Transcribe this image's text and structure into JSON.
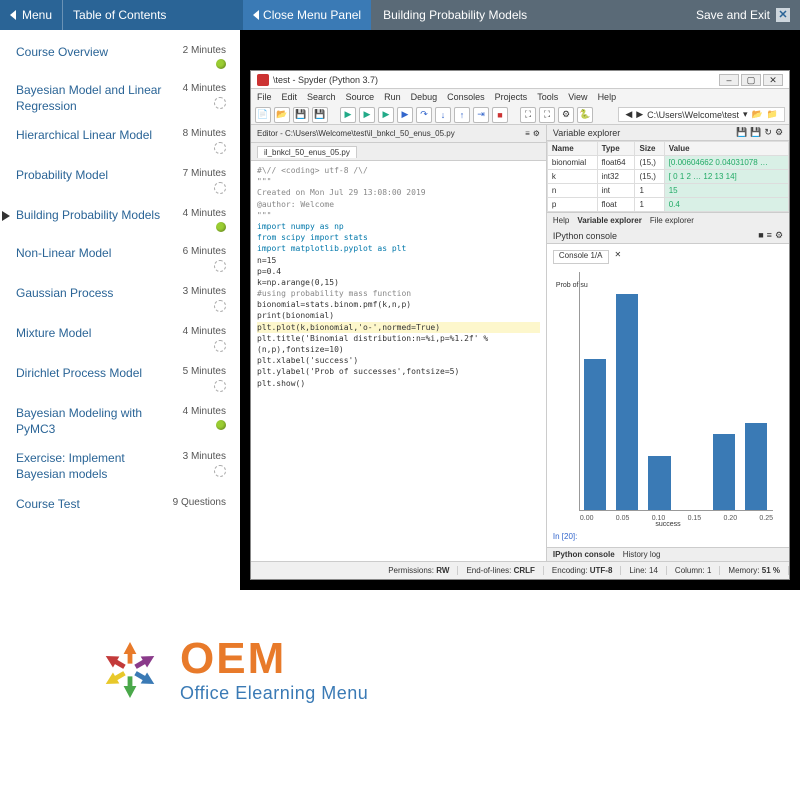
{
  "topbar": {
    "menu": "Menu",
    "toc": "Table of Contents",
    "close_panel": "Close Menu Panel",
    "title": "Building Probability Models",
    "save": "Save and Exit"
  },
  "sidebar": {
    "items": [
      {
        "label": "Course Overview",
        "meta": "2 Minutes",
        "status": "done",
        "active": false
      },
      {
        "label": "Bayesian Model and Linear Regression",
        "meta": "4 Minutes",
        "status": "loading",
        "active": false
      },
      {
        "label": "Hierarchical Linear Model",
        "meta": "8 Minutes",
        "status": "loading",
        "active": false
      },
      {
        "label": "Probability Model",
        "meta": "7 Minutes",
        "status": "loading",
        "active": false
      },
      {
        "label": "Building Probability Models",
        "meta": "4 Minutes",
        "status": "done",
        "active": true
      },
      {
        "label": "Non-Linear Model",
        "meta": "6 Minutes",
        "status": "loading",
        "active": false
      },
      {
        "label": "Gaussian Process",
        "meta": "3 Minutes",
        "status": "loading",
        "active": false
      },
      {
        "label": "Mixture Model",
        "meta": "4 Minutes",
        "status": "loading",
        "active": false
      },
      {
        "label": "Dirichlet Process Model",
        "meta": "5 Minutes",
        "status": "loading",
        "active": false
      },
      {
        "label": "Bayesian Modeling with PyMC3",
        "meta": "4 Minutes",
        "status": "done",
        "active": false
      },
      {
        "label": "Exercise: Implement Bayesian models",
        "meta": "3 Minutes",
        "status": "loading",
        "active": false
      },
      {
        "label": "Course Test",
        "meta": "9 Questions",
        "status": "none",
        "active": false
      }
    ]
  },
  "ide": {
    "window_title": "\\test - Spyder (Python 3.7)",
    "menubar": [
      "File",
      "Edit",
      "Search",
      "Source",
      "Run",
      "Debug",
      "Consoles",
      "Projects",
      "Tools",
      "View",
      "Help"
    ],
    "path": "C:\\Users\\Welcome\\test",
    "editor_tab_path": "Editor - C:\\Users\\Welcome\\test\\il_bnkcl_50_enus_05.py",
    "editor_tab": "il_bnkcl_50_enus_05.py",
    "code_lines": [
      {
        "cls": "cm",
        "t": "#\\//   <coding> utf-8  /\\/"
      },
      {
        "cls": "cm",
        "t": "\"\"\""
      },
      {
        "cls": "cm",
        "t": "Created on Mon Jul 29 13:08:00 2019"
      },
      {
        "cls": "cm",
        "t": ""
      },
      {
        "cls": "cm",
        "t": "@author: Welcome"
      },
      {
        "cls": "cm",
        "t": "\"\"\""
      },
      {
        "cls": "kw",
        "t": "import numpy as np"
      },
      {
        "cls": "kw",
        "t": "from scipy import stats"
      },
      {
        "cls": "kw",
        "t": "import matplotlib.pyplot as plt"
      },
      {
        "cls": "",
        "t": "n=15"
      },
      {
        "cls": "",
        "t": "p=0.4"
      },
      {
        "cls": "",
        "t": "k=np.arange(0,15)"
      },
      {
        "cls": "cm",
        "t": "#using probability mass function"
      },
      {
        "cls": "",
        "t": "bionomial=stats.binom.pmf(k,n,p)"
      },
      {
        "cls": "",
        "t": "print(bionomial)"
      },
      {
        "cls": "hl",
        "t": "plt.plot(k,bionomial,'o-',normed=True)"
      },
      {
        "cls": "",
        "t": "plt.title('Binomial distribution:n=%i,p=%1.2f' % (n,p),fontsize=10)"
      },
      {
        "cls": "",
        "t": "plt.xlabel('success')"
      },
      {
        "cls": "",
        "t": "plt.ylabel('Prob of successes',fontsize=5)"
      },
      {
        "cls": "",
        "t": "plt.show()"
      }
    ],
    "varex_title": "Variable explorer",
    "varex_headers": [
      "Name",
      "Type",
      "Size",
      "Value"
    ],
    "varex_rows": [
      {
        "name": "bionomial",
        "type": "float64",
        "size": "(15,)",
        "value": "[0.00604662 0.04031078 …"
      },
      {
        "name": "k",
        "type": "int32",
        "size": "(15,)",
        "value": "[ 0  1  2 … 12 13 14]"
      },
      {
        "name": "n",
        "type": "int",
        "size": "1",
        "value": "15"
      },
      {
        "name": "p",
        "type": "float",
        "size": "1",
        "value": "0.4"
      }
    ],
    "varex_tabs": [
      "Help",
      "Variable explorer",
      "File explorer"
    ],
    "console_title": "IPython console",
    "console_tab": "Console 1/A",
    "console_prompt": "In [20]:",
    "console_footer_tabs": [
      "IPython console",
      "History log"
    ],
    "plot_ylabel": "Prob of su",
    "plot_xlabel": "success",
    "plot_xticks": [
      "0.00",
      "0.05",
      "0.10",
      "0.15",
      "0.20",
      "0.25"
    ],
    "status": {
      "perm_label": "Permissions:",
      "perm": "RW",
      "eol_label": "End-of-lines:",
      "eol": "CRLF",
      "enc_label": "Encoding:",
      "enc": "UTF-8",
      "line_label": "Line:",
      "line": "14",
      "col_label": "Column:",
      "col": "1",
      "mem_label": "Memory:",
      "mem": "51 %"
    }
  },
  "logo": {
    "text": "OEM",
    "sub": "Office Elearning Menu"
  },
  "chart_data": {
    "type": "bar",
    "title": "",
    "xlabel": "success",
    "ylabel": "Prob of successes",
    "x": [
      0.0,
      0.05,
      0.1,
      0.15,
      0.2,
      0.25
    ],
    "values": [
      0.14,
      0.2,
      0.05,
      0.0,
      0.07,
      0.08
    ],
    "ylim": [
      0,
      0.22
    ]
  }
}
